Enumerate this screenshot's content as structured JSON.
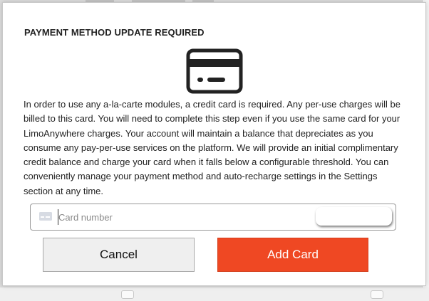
{
  "modal": {
    "title": "PAYMENT METHOD UPDATE REQUIRED",
    "icon": "credit-card-icon",
    "body": "In order to use any a-la-carte modules, a credit card is required. Any per-use charges will be billed to this card. You will need to complete this step even if you use the same card for your LimoAnywhere charges. Your account will maintain a balance that depreciates as you consume any pay-per-use services on the platform. We will provide an initial complimentary credit balance and charge your card when it falls below a configurable threshold. You can conveniently manage your payment method and auto-recharge settings in the Settings section at any time.",
    "card_field": {
      "icon": "card-brand-icon",
      "placeholder": "Card number",
      "value": ""
    },
    "buttons": {
      "cancel_label": "Cancel",
      "add_label": "Add Card"
    }
  },
  "colors": {
    "accent": "#ef4823",
    "cancel_bg": "#efefef",
    "text": "#222222"
  }
}
